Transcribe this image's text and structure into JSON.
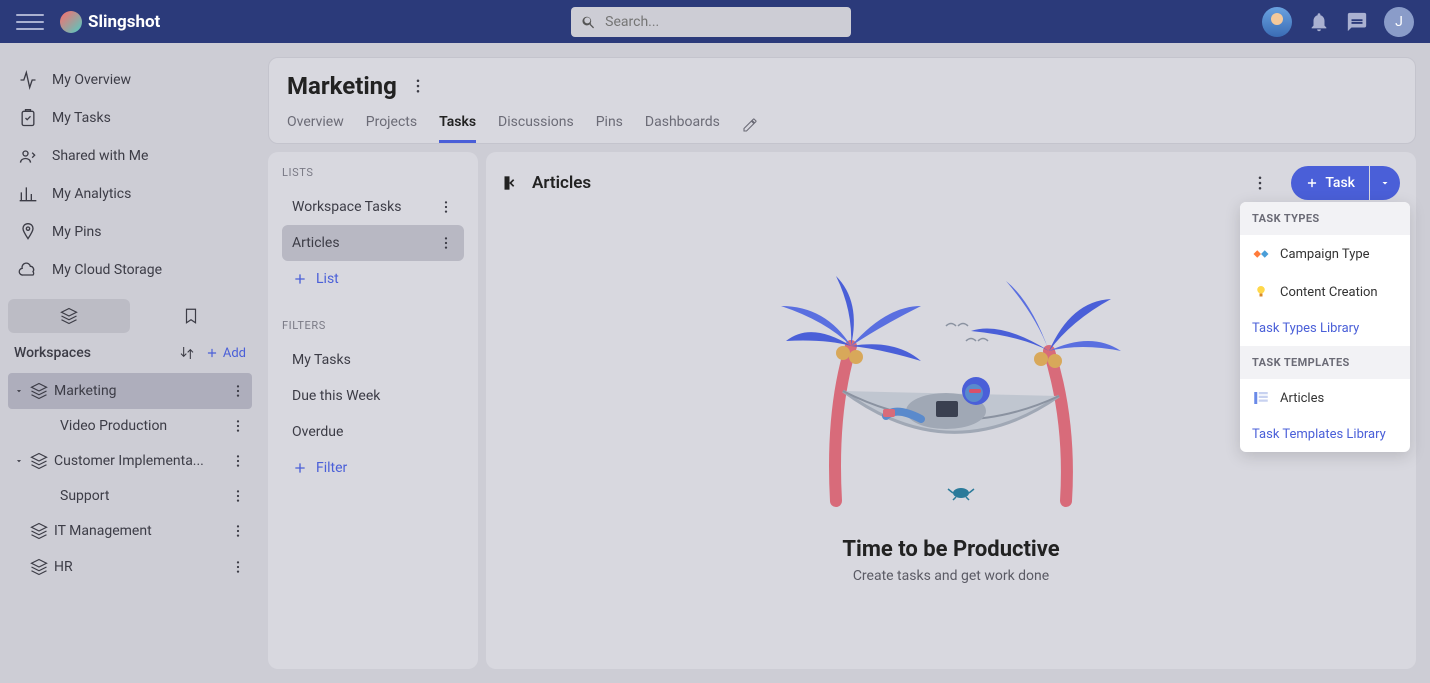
{
  "app_name": "Slingshot",
  "search_placeholder": "Search...",
  "user_initial": "J",
  "sidebar_nav": [
    {
      "label": "My Overview"
    },
    {
      "label": "My Tasks"
    },
    {
      "label": "Shared with Me"
    },
    {
      "label": "My Analytics"
    },
    {
      "label": "My Pins"
    },
    {
      "label": "My Cloud Storage"
    }
  ],
  "workspaces_label": "Workspaces",
  "add_label": "Add",
  "workspaces": [
    {
      "name": "Marketing",
      "selected": true,
      "expanded": true
    },
    {
      "name": "Video Production",
      "child": true
    },
    {
      "name": "Customer Implementa...",
      "expanded": true
    },
    {
      "name": "Support",
      "child": true
    },
    {
      "name": "IT Management"
    },
    {
      "name": "HR"
    }
  ],
  "page_title": "Marketing",
  "tabs": [
    "Overview",
    "Projects",
    "Tasks",
    "Discussions",
    "Pins",
    "Dashboards"
  ],
  "active_tab": "Tasks",
  "lists_label": "LISTS",
  "lists": [
    "Workspace Tasks",
    "Articles"
  ],
  "selected_list": "Articles",
  "add_list_label": "List",
  "filters_label": "FILTERS",
  "filters": [
    "My Tasks",
    "Due this Week",
    "Overdue"
  ],
  "add_filter_label": "Filter",
  "tasks_title": "Articles",
  "task_button": "Task",
  "empty_title": "Time to be Productive",
  "empty_sub": "Create tasks and get work done",
  "dropdown": {
    "types_header": "TASK TYPES",
    "types": [
      "Campaign Type",
      "Content Creation"
    ],
    "types_link": "Task Types Library",
    "templates_header": "TASK TEMPLATES",
    "templates": [
      "Articles"
    ],
    "templates_link": "Task Templates Library"
  }
}
